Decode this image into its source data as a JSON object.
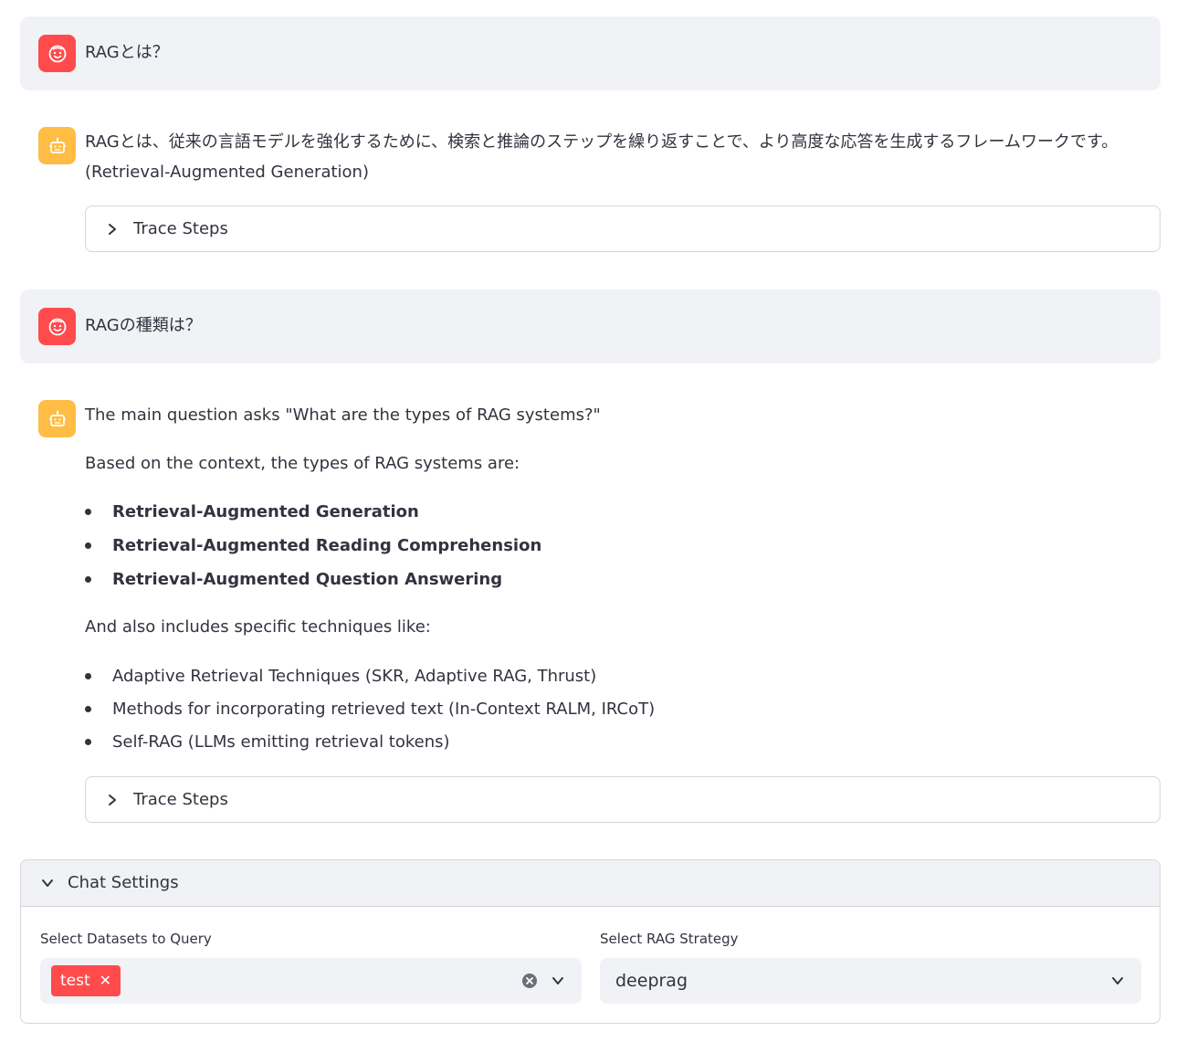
{
  "messages": [
    {
      "role": "user",
      "text": "RAGとは？"
    },
    {
      "role": "assistant",
      "text": "RAGとは、従来の言語モデルを強化するために、検索と推論のステップを繰り返すことで、より高度な応答を生成するフレームワークです。 (Retrieval-Augmented Generation)",
      "expander_label": "Trace Steps"
    },
    {
      "role": "user",
      "text": "RAGの種類は？"
    },
    {
      "role": "assistant",
      "intro": "The main question asks \"What are the types of RAG systems?\"",
      "context_line": "Based on the context, the types of RAG systems are:",
      "types": [
        "Retrieval-Augmented Generation",
        "Retrieval-Augmented Reading Comprehension",
        "Retrieval-Augmented Question Answering"
      ],
      "techniques_intro": "And also includes specific techniques like:",
      "techniques": [
        "Adaptive Retrieval Techniques (SKR, Adaptive RAG, Thrust)",
        "Methods for incorporating retrieved text (In-Context RALM, IRCoT)",
        "Self-RAG (LLMs emitting retrieval tokens)"
      ],
      "expander_label": "Trace Steps"
    }
  ],
  "settings": {
    "title": "Chat Settings",
    "datasets_label": "Select Datasets to Query",
    "datasets_selected": [
      "test"
    ],
    "strategy_label": "Select RAG Strategy",
    "strategy_value": "deeprag"
  },
  "colors": {
    "user_avatar": "#ff4b4b",
    "bot_avatar": "#ffbd45",
    "tag": "#ff4b4b",
    "surface": "#f0f2f6"
  },
  "icons": {
    "user_avatar": "smiley-face-icon",
    "bot_avatar": "robot-icon",
    "expander": "chevron-right-icon",
    "settings_toggle": "chevron-down-icon",
    "clear": "clear-circle-icon",
    "dropdown": "chevron-down-icon"
  }
}
